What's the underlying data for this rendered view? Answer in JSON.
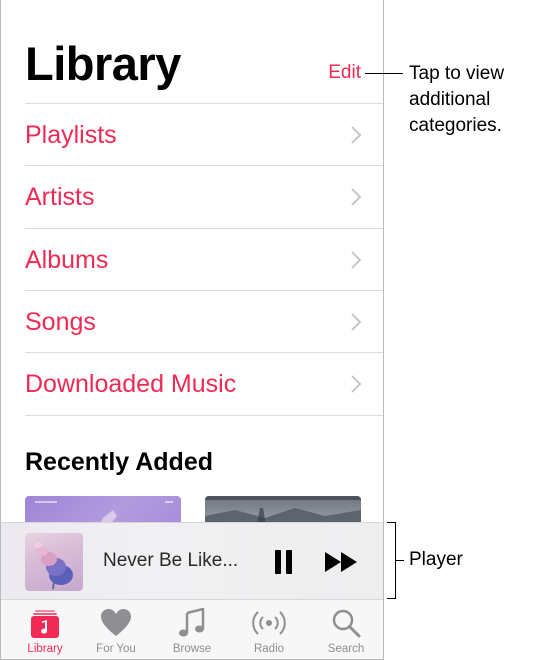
{
  "library": {
    "title": "Library",
    "edit_label": "Edit",
    "items": [
      {
        "label": "Playlists"
      },
      {
        "label": "Artists"
      },
      {
        "label": "Albums"
      },
      {
        "label": "Songs"
      },
      {
        "label": "Downloaded Music"
      }
    ],
    "recently_added_title": "Recently Added"
  },
  "player": {
    "song_title": "Never Be Like...",
    "pause_icon": "pause-icon",
    "next_icon": "fast-forward-icon"
  },
  "tabbar": {
    "tabs": [
      {
        "label": "Library",
        "icon": "library-icon",
        "active": true
      },
      {
        "label": "For You",
        "icon": "heart-icon",
        "active": false
      },
      {
        "label": "Browse",
        "icon": "music-note-icon",
        "active": false
      },
      {
        "label": "Radio",
        "icon": "radio-icon",
        "active": false
      },
      {
        "label": "Search",
        "icon": "search-icon",
        "active": false
      }
    ]
  },
  "callouts": {
    "edit_line1": "Tap to view",
    "edit_line2": "additional",
    "edit_line3": "categories.",
    "player": "Player"
  },
  "colors": {
    "accent": "#f02a55",
    "inactive_tab": "#8e8e93"
  }
}
